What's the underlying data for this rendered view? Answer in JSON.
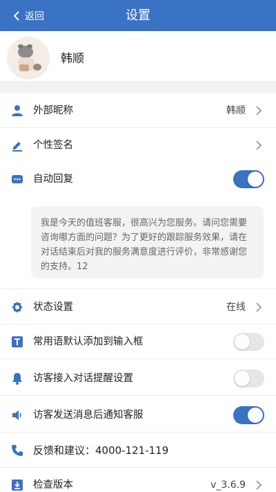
{
  "header": {
    "back_label": "返回",
    "title": "设置"
  },
  "profile": {
    "name": "韩顺"
  },
  "colors": {
    "accent": "#3a72c4",
    "toggle_off": "#e6e6e6"
  },
  "settings": {
    "nickname": {
      "label": "外部昵称",
      "value": "韩顺",
      "icon": "person-icon"
    },
    "signature": {
      "label": "个性签名",
      "icon": "pencil-icon"
    },
    "auto_reply": {
      "label": "自动回复",
      "enabled": true,
      "icon": "chat-bubble-icon",
      "message": "我是今天的值班客服，很高兴为您服务。请问您需要咨询哪方面的问题？为了更好的跟踪服务效果，请在对话结束后对我的服务满意度进行评价，非常感谢您的支持。12"
    },
    "status": {
      "label": "状态设置",
      "value": "在线",
      "icon": "gear-icon"
    },
    "common_phrase": {
      "label": "常用语默认添加到输入框",
      "enabled": false,
      "icon": "text-box-icon"
    },
    "visitor_reminder": {
      "label": "访客接入对话提醒设置",
      "enabled": false,
      "icon": "bell-icon"
    },
    "visitor_notify": {
      "label": "访客发送消息后通知客服",
      "enabled": true,
      "icon": "speaker-icon"
    },
    "feedback": {
      "label": "反馈和建议：4000-121-119",
      "icon": "phone-icon"
    },
    "version": {
      "label": "检查版本",
      "value": "v_3.6.9",
      "icon": "download-icon"
    }
  }
}
